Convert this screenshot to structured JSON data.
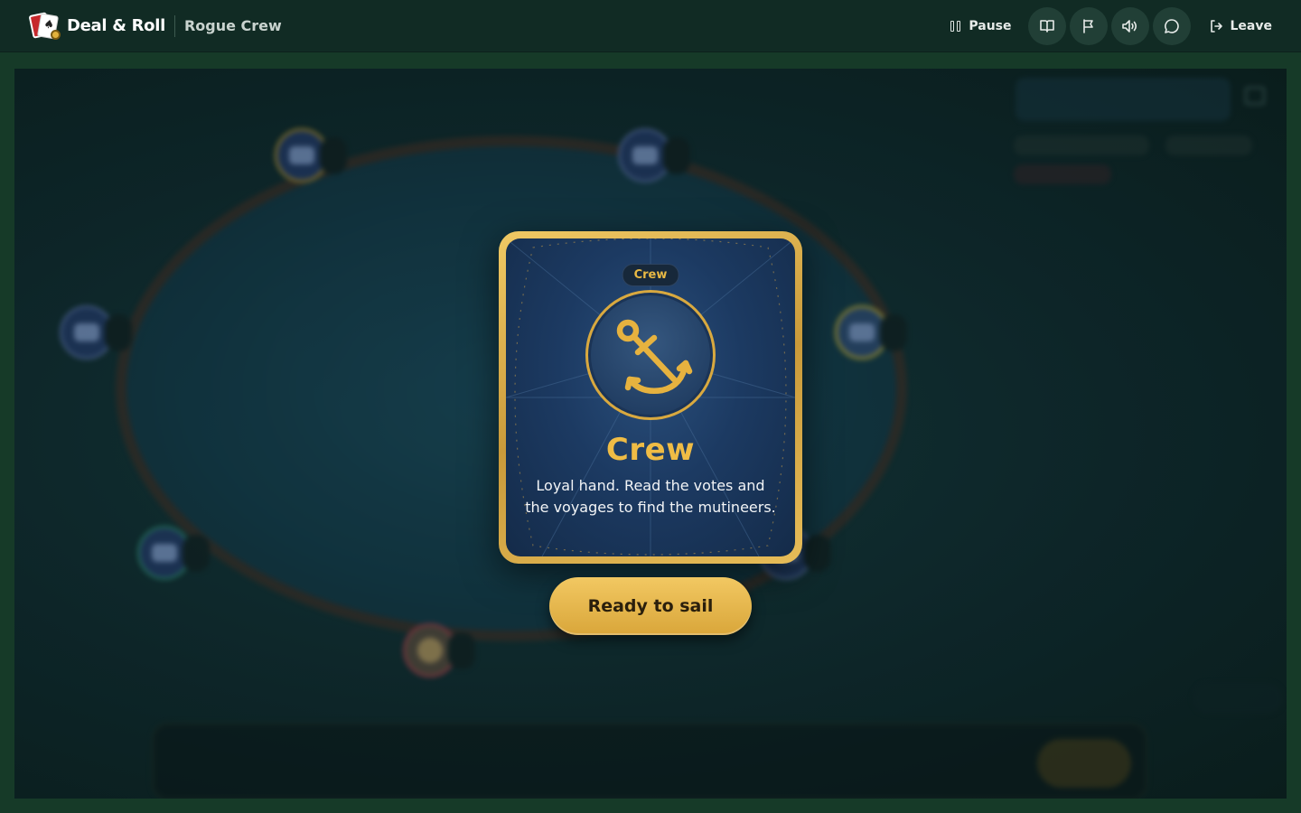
{
  "app": {
    "name": "Deal & Roll",
    "room": "Rogue Crew"
  },
  "toolbar": {
    "pause_label": "Pause",
    "leave_label": "Leave",
    "icons": [
      "book-icon",
      "flag-icon",
      "speaker-icon",
      "chat-icon"
    ]
  },
  "role_card": {
    "badge": "Crew",
    "title": "Crew",
    "description": "Loyal hand. Read the votes and the voyages to find the mutineers.",
    "emblem": "anchor-icon"
  },
  "actions": {
    "ready_label": "Ready to sail"
  },
  "colors": {
    "accent_gold": "#efbc45",
    "topbar": "#112b24",
    "page_bg": "#163a28",
    "card_blue": "#1c3a62"
  }
}
